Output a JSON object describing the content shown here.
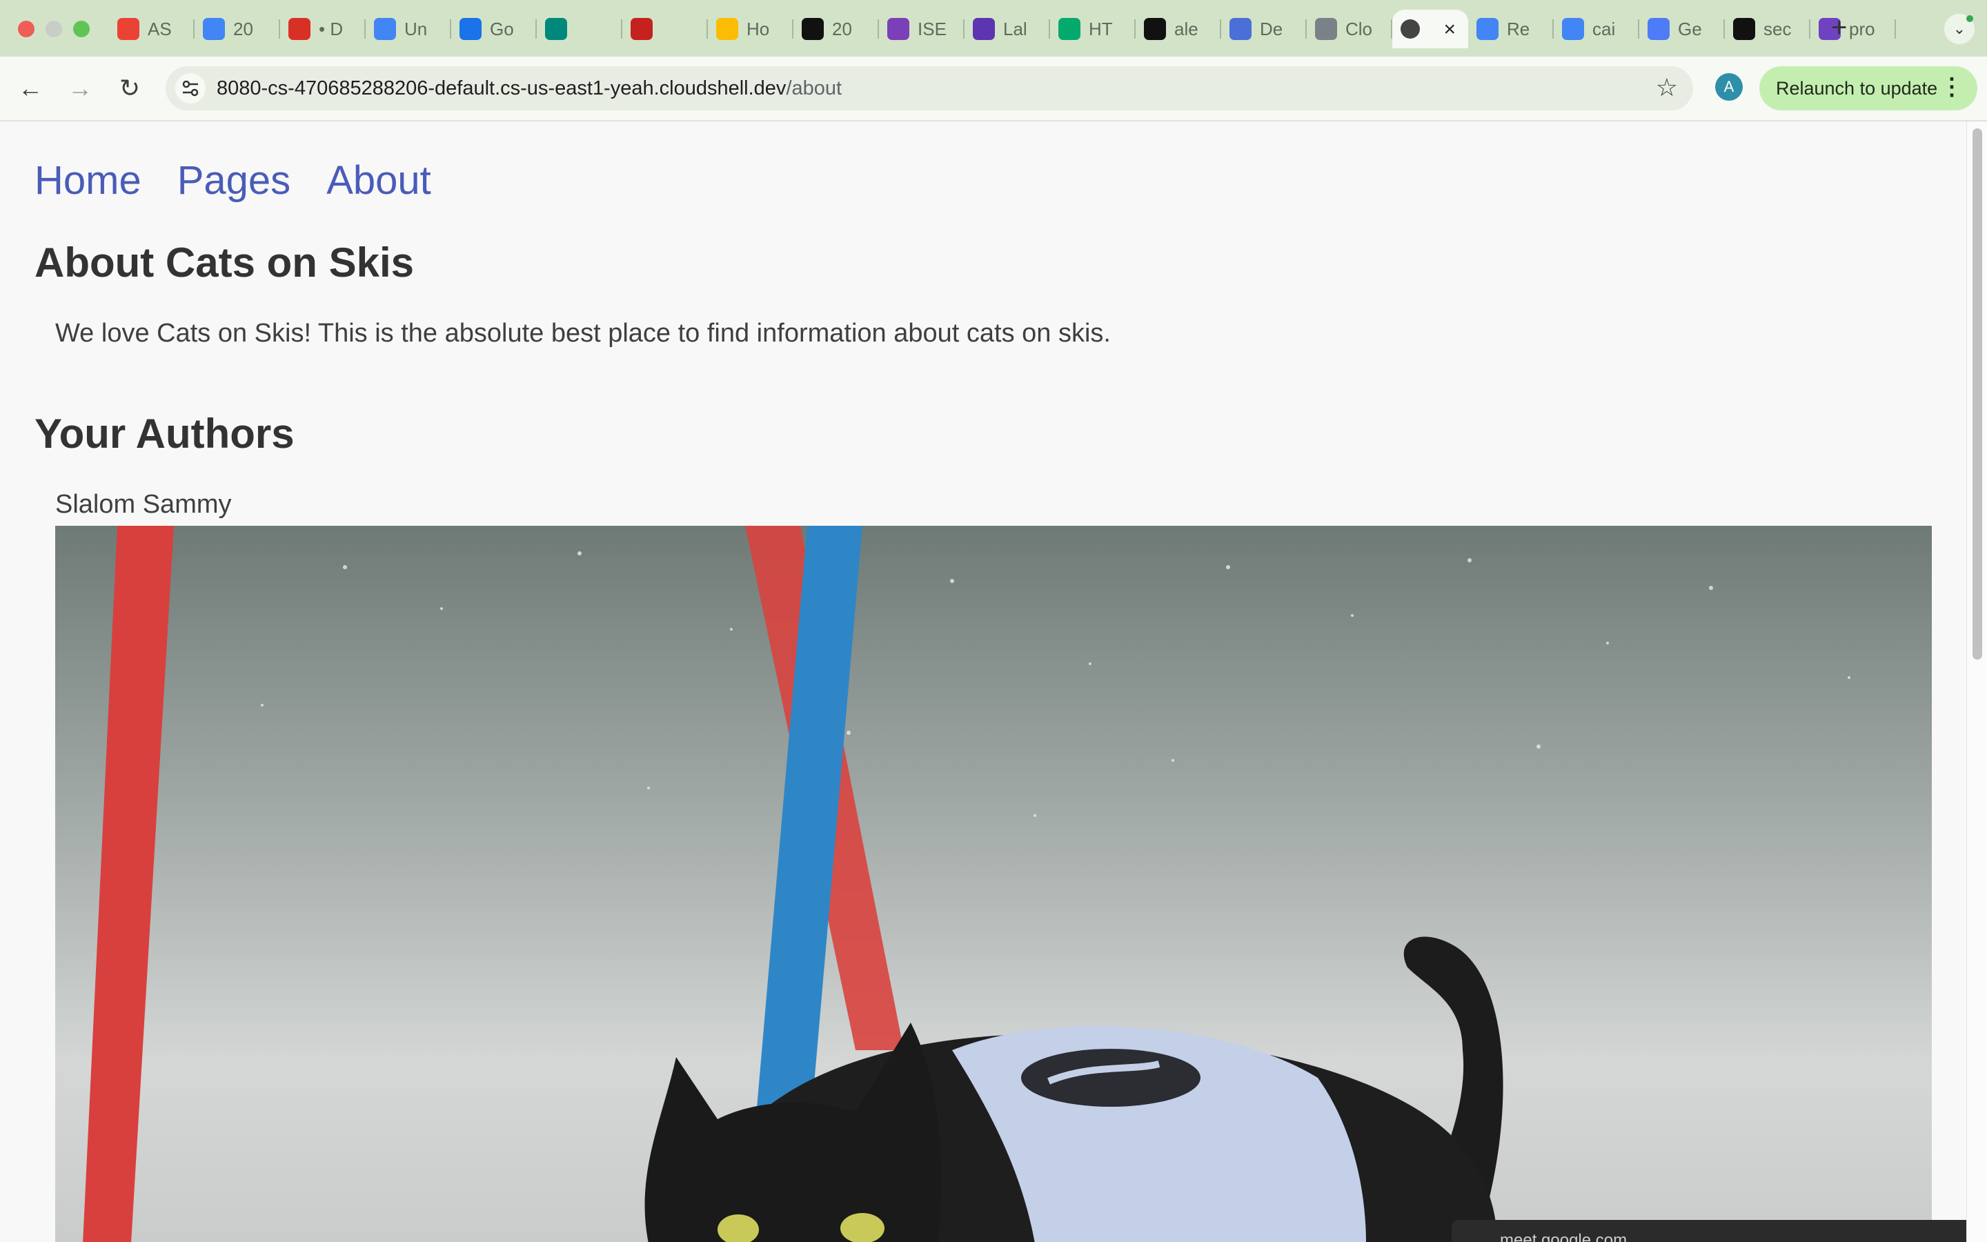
{
  "browser": {
    "tabs": [
      {
        "title": "AS",
        "icon": "gmail-icon",
        "color": "#ea4335"
      },
      {
        "title": "20",
        "icon": "list-icon",
        "color": "#4285f4"
      },
      {
        "title": "• D",
        "icon": "chrome-remote-icon",
        "color": "#d93025"
      },
      {
        "title": "Un",
        "icon": "docs-icon",
        "color": "#4285f4"
      },
      {
        "title": "Go",
        "icon": "calendar-icon",
        "color": "#1a73e8"
      },
      {
        "title": "",
        "icon": "meet-icon",
        "color": "#00897b"
      },
      {
        "title": "",
        "icon": "record-icon",
        "color": "#c5221f"
      },
      {
        "title": "Ho",
        "icon": "drive-icon",
        "color": "#fbbc04"
      },
      {
        "title": "20",
        "icon": "openai-icon",
        "color": "#111111"
      },
      {
        "title": "ISE",
        "icon": "ed-icon",
        "color": "#7b3fb8"
      },
      {
        "title": "Lal",
        "icon": "forms-icon",
        "color": "#5e35b1"
      },
      {
        "title": "HT",
        "icon": "w3schools-icon",
        "color": "#04aa6d"
      },
      {
        "title": "ale",
        "icon": "github-icon",
        "color": "#111111"
      },
      {
        "title": "De",
        "icon": "shield-icon",
        "color": "#4a6fd8"
      },
      {
        "title": "Clo",
        "icon": "monitor-icon",
        "color": "#7a8288"
      },
      {
        "title": "",
        "icon": "globe-icon",
        "color": "#444444",
        "active": true
      },
      {
        "title": "Re",
        "icon": "search-doc-icon",
        "color": "#4285f4"
      },
      {
        "title": "cai",
        "icon": "google-icon",
        "color": "#4285f4"
      },
      {
        "title": "Ge",
        "icon": "gemini-icon",
        "color": "#4e7cf6"
      },
      {
        "title": "sec",
        "icon": "github-icon",
        "color": "#111111"
      },
      {
        "title": "pro",
        "icon": "badge-icon",
        "color": "#6f42c1"
      }
    ],
    "url_host": "8080-cs-470685288206-default.cs-us-east1-yeah.cloudshell.dev",
    "url_path": "/about",
    "profile_initial": "A",
    "relaunch_label": "Relaunch to update"
  },
  "site": {
    "nav": [
      "Home",
      "Pages",
      "About"
    ],
    "title": "About Cats on Skis",
    "intro": "We love Cats on Skis! This is the absolute best place to find information about cats on skis.",
    "authors_heading": "Your Authors",
    "author_name": "Slalom Sammy"
  },
  "overlay": {
    "meet_chip": "meet.google.com"
  },
  "colors": {
    "tabstrip": "#d3e3c8",
    "link": "#4a5cb8",
    "relaunch": "#c4eeb0"
  }
}
